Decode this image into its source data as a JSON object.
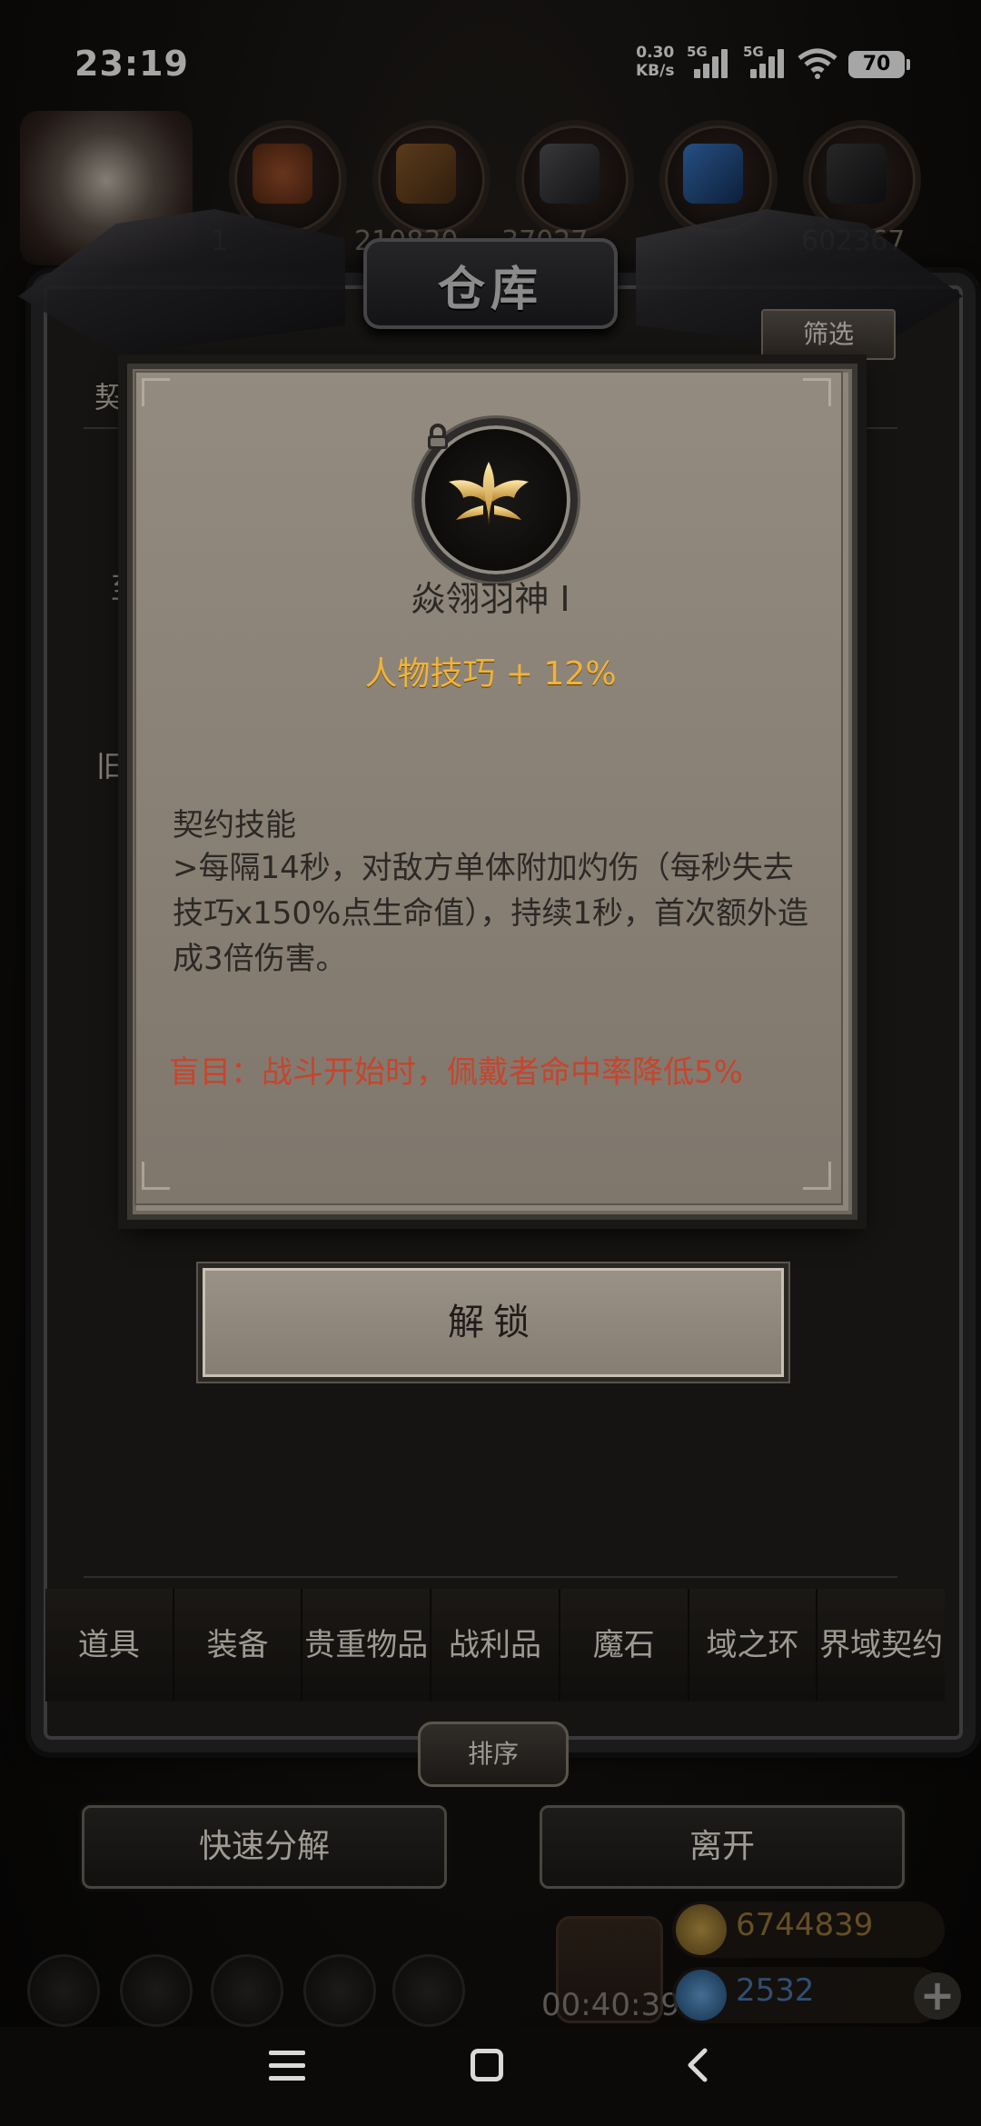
{
  "status_bar": {
    "time": "23:19",
    "net_speed": "0.30",
    "net_unit": "KB/s",
    "signal1_label": "5G",
    "signal2_label": "5G",
    "battery": "70"
  },
  "hud": {
    "resources": [
      "1",
      "210830",
      "37027",
      "",
      "",
      "602367"
    ]
  },
  "warehouse": {
    "title": "仓库",
    "filter_label": "筛选",
    "left_tabs": [
      "契",
      "至",
      "旧"
    ],
    "categories": [
      "道具",
      "装备",
      "贵重物品",
      "战利品",
      "魔石",
      "域之环",
      "界域契约"
    ],
    "sort_label": "排序",
    "quick_decompose_label": "快速分解",
    "leave_label": "离开"
  },
  "item_card": {
    "name": "焱翎羽神 I",
    "stat": "人物技巧 + 12%",
    "skill_title": "契约技能",
    "skill_desc": ">每隔14秒，对敌方单体附加灼伤（每秒失去技巧x150%点生命值），持续1秒，首次额外造成3倍伤害。",
    "debuff": "盲目：战斗开始时，佩戴者命中率降低5%",
    "unlock_label": "解锁"
  },
  "bottom_hud": {
    "gift_timer": "00:40:39",
    "gold": "6744839",
    "gems": "2532",
    "plus_label": "+"
  },
  "colors": {
    "stat_gold": "#f0b33a",
    "debuff_red": "#c8442c",
    "card_bg": "#8d857a"
  },
  "icons": [
    "lock-icon",
    "phoenix-emblem-icon",
    "menu-icon",
    "home-icon",
    "back-icon",
    "wifi-icon",
    "signal-icon",
    "gift-icon",
    "coin-icon",
    "gem-icon",
    "plus-icon"
  ]
}
